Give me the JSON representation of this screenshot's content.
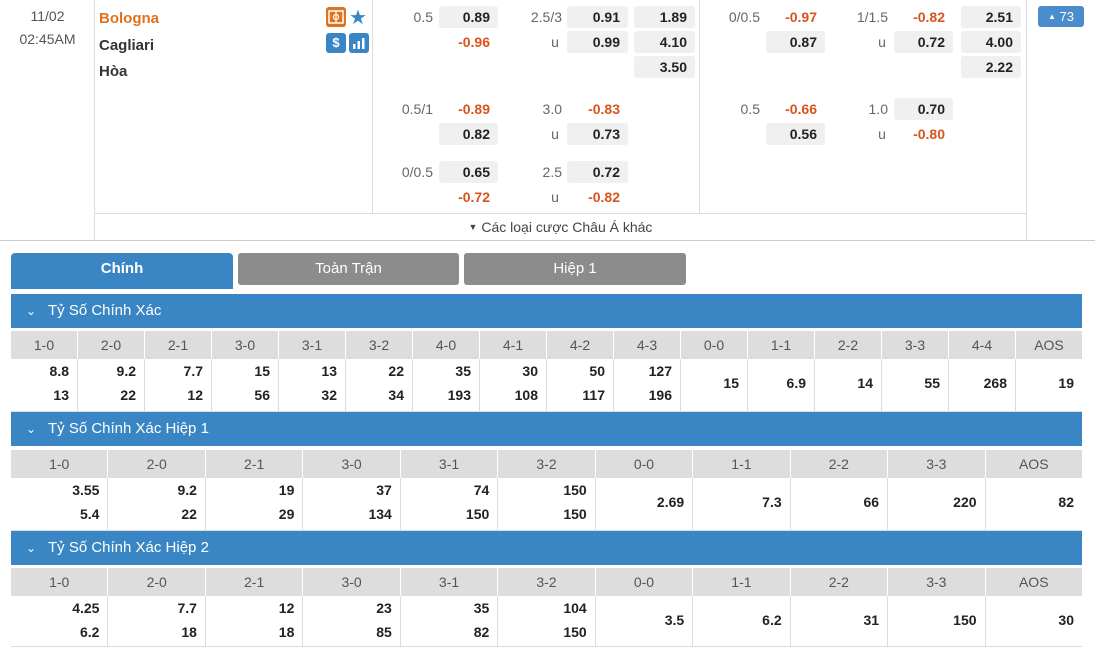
{
  "match": {
    "date": "11/02",
    "time": "02:45AM",
    "home": "Bologna",
    "away": "Cagliari",
    "draw": "Hòa",
    "more_count": "73",
    "dollar_label": "$"
  },
  "odds": {
    "r1": {
      "h1_hdp": "0.5",
      "h1_home": "0.89",
      "h1_away": "-0.96",
      "h1_ou": "2.5/3",
      "h1_over": "0.91",
      "h1_u": "u",
      "h1_under": "0.99",
      "x12_1": "1.89",
      "x12_2": "4.10",
      "x12_x": "3.50",
      "fh_hdp": "0/0.5",
      "fh_home": "-0.97",
      "fh_away": "0.87",
      "fh_ou": "1/1.5",
      "fh_over": "-0.82",
      "fh_u": "u",
      "fh_under": "0.72",
      "fh12_1": "2.51",
      "fh12_2": "4.00",
      "fh12_x": "2.22"
    },
    "r2": {
      "h1_hdp": "0.5/1",
      "h1_home": "-0.89",
      "h1_away": "0.82",
      "h1_ou": "3.0",
      "h1_over": "-0.83",
      "h1_u": "u",
      "h1_under": "0.73",
      "fh_hdp": "0.5",
      "fh_home": "-0.66",
      "fh_away": "0.56",
      "fh_ou": "1.0",
      "fh_over": "0.70",
      "fh_u": "u",
      "fh_under": "-0.80"
    },
    "r3": {
      "h1_hdp": "0/0.5",
      "h1_home": "0.65",
      "h1_away": "-0.72",
      "h1_ou": "2.5",
      "h1_over": "0.72",
      "h1_u": "u",
      "h1_under": "-0.82"
    },
    "more_link": "Các loại cược Châu Á khác"
  },
  "tabs": [
    "Chính",
    "Toàn Trận",
    "Hiệp 1"
  ],
  "sections": [
    {
      "title": "Tỷ Số Chính Xác",
      "headers": [
        "1-0",
        "2-0",
        "2-1",
        "3-0",
        "3-1",
        "3-2",
        "4-0",
        "4-1",
        "4-2",
        "4-3",
        "0-0",
        "1-1",
        "2-2",
        "3-3",
        "4-4",
        "AOS"
      ],
      "home": [
        "8.8",
        "9.2",
        "7.7",
        "15",
        "13",
        "22",
        "35",
        "30",
        "50",
        "127"
      ],
      "away": [
        "13",
        "22",
        "12",
        "56",
        "32",
        "34",
        "193",
        "108",
        "117",
        "196"
      ],
      "single": [
        "15",
        "6.9",
        "14",
        "55",
        "268",
        "19"
      ]
    },
    {
      "title": "Tỷ Số Chính Xác Hiệp 1",
      "headers": [
        "1-0",
        "2-0",
        "2-1",
        "3-0",
        "3-1",
        "3-2",
        "0-0",
        "1-1",
        "2-2",
        "3-3",
        "AOS"
      ],
      "home": [
        "3.55",
        "9.2",
        "19",
        "37",
        "74",
        "150"
      ],
      "away": [
        "5.4",
        "22",
        "29",
        "134",
        "150",
        "150"
      ],
      "single": [
        "2.69",
        "7.3",
        "66",
        "220",
        "82"
      ]
    },
    {
      "title": "Tỷ Số Chính Xác Hiệp 2",
      "headers": [
        "1-0",
        "2-0",
        "2-1",
        "3-0",
        "3-1",
        "3-2",
        "0-0",
        "1-1",
        "2-2",
        "3-3",
        "AOS"
      ],
      "home": [
        "4.25",
        "7.7",
        "12",
        "23",
        "35",
        "104"
      ],
      "away": [
        "6.2",
        "18",
        "18",
        "85",
        "82",
        "150"
      ],
      "single": [
        "3.5",
        "6.2",
        "31",
        "150",
        "30"
      ]
    }
  ],
  "colors": {
    "accent": "#3a86c4",
    "negative": "#d9541d",
    "home": "#e0711d",
    "tab_inactive": "#8c8c8c"
  }
}
